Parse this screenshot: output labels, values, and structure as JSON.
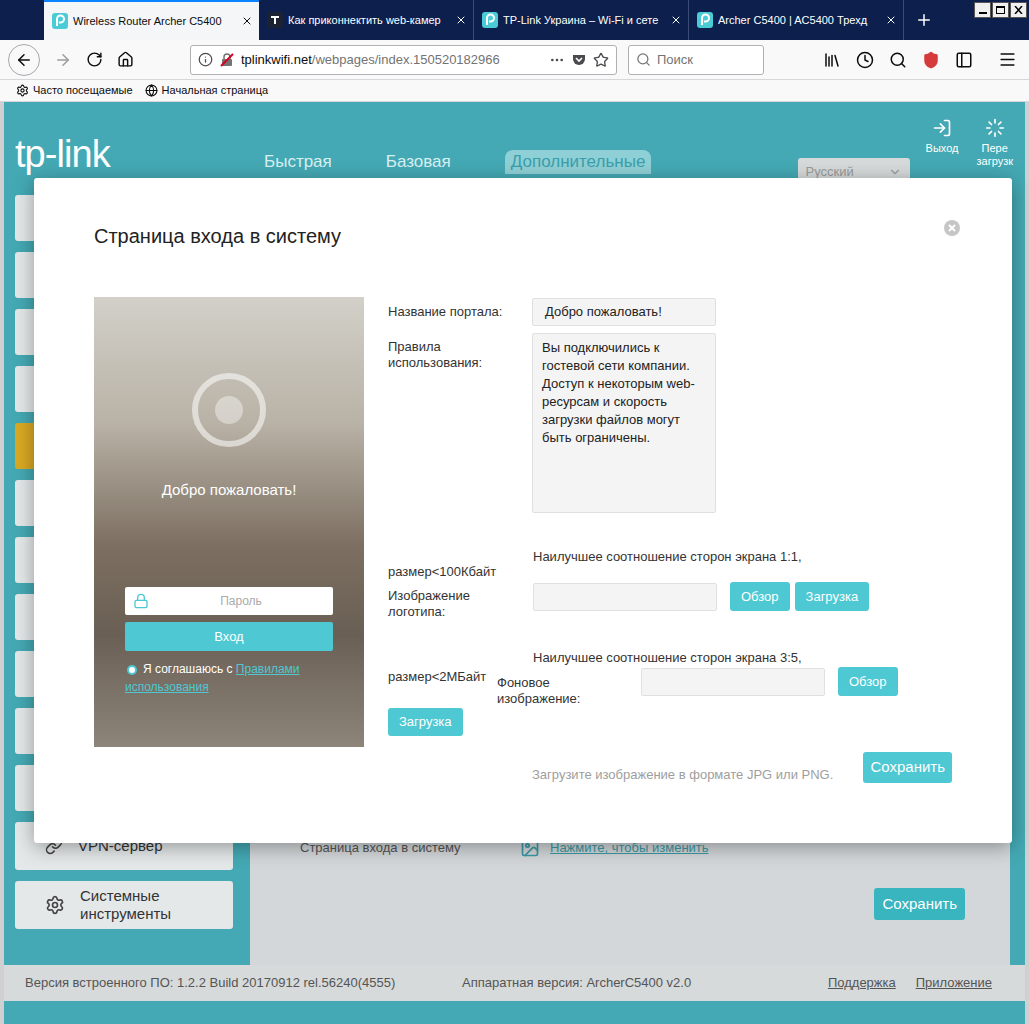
{
  "browser": {
    "tabs": [
      {
        "title": "Wireless Router Archer C5400",
        "selected": true,
        "kind": "tplink"
      },
      {
        "title": "Как приконнектить web-камер",
        "selected": false,
        "kind": "dark"
      },
      {
        "title": "TP-Link Украина – Wi-Fi и сете",
        "selected": false,
        "kind": "tplink"
      },
      {
        "title": "Archer C5400 | AC5400 Трехд",
        "selected": false,
        "kind": "tplink"
      }
    ],
    "address": {
      "host": "tplinkwifi.net",
      "path": "/webpages/index.150520182966"
    },
    "search": {
      "placeholder": "Поиск"
    },
    "bookmarks": [
      "Часто посещаемые",
      "Начальная страница"
    ]
  },
  "router": {
    "logo": "tp-link",
    "nav": [
      {
        "label": "Быстрая",
        "selected": false
      },
      {
        "label": "Базовая",
        "selected": false
      },
      {
        "label": "Дополнительные",
        "selected": true
      }
    ],
    "language": "Русский",
    "actions": [
      {
        "label_lines": [
          "Выход"
        ],
        "kind": "logout"
      },
      {
        "label_lines": [
          "Пере",
          "загрузк"
        ],
        "kind": "reboot"
      }
    ],
    "sidebar": {
      "hidden_items": [
        {
          "selected": false
        },
        {
          "selected": false
        },
        {
          "selected": false
        },
        {
          "selected": false
        },
        {
          "selected": true
        },
        {
          "selected": false
        },
        {
          "selected": false
        },
        {
          "selected": false
        },
        {
          "selected": false
        },
        {
          "selected": false
        },
        {
          "selected": false
        }
      ],
      "items": [
        {
          "label": "VPN-сервер",
          "kind": "vpn"
        },
        {
          "label": "Системные инструменты",
          "kind": "tools"
        }
      ]
    },
    "content": {
      "row_label": "Страница входа в систему",
      "link": "Нажмите, чтобы изменить",
      "save": "Сохранить"
    },
    "footer": {
      "firmware": "Версия встроенного ПО: 1.2.2 Build 20170912 rel.56240(4555)",
      "hardware": "Аппаратная версия: ArcherC5400 v2.0",
      "links": [
        "Поддержка",
        "Приложение"
      ]
    }
  },
  "dialog": {
    "title": "Страница входа в систему",
    "preview": {
      "portal_title": "Добро пожаловать!",
      "password_placeholder": "Пароль",
      "login_button": "Вход",
      "agree_text": "Я соглашаюсь с",
      "agree_link": "Правилами использования",
      "agreed": false
    },
    "portal_name": {
      "label": "Название портала:",
      "value": "Добро пожаловать!"
    },
    "rules": {
      "label": "Правила использования:",
      "value": "Вы подключились к гостевой сети компании. Доступ к некоторым web-ресурсам и скорость загрузки файлов могут быть ограничены."
    },
    "logo_upload": {
      "hint": "Наилучшее соотношение сторон экрана 1:1,",
      "size": "размер<100Кбайт",
      "label": "Изображение логотипа:",
      "browse": "Обзор",
      "upload": "Загрузка"
    },
    "background_upload": {
      "hint": "Наилучшее соотношение сторон экрана 3:5,",
      "size": "размер<2МБайт",
      "label": "Фоновое изображение:",
      "browse": "Обзор",
      "upload": "Загрузка"
    },
    "format_note": "Загрузите изображение в формате JPG или PNG.",
    "save": "Сохранить"
  }
}
